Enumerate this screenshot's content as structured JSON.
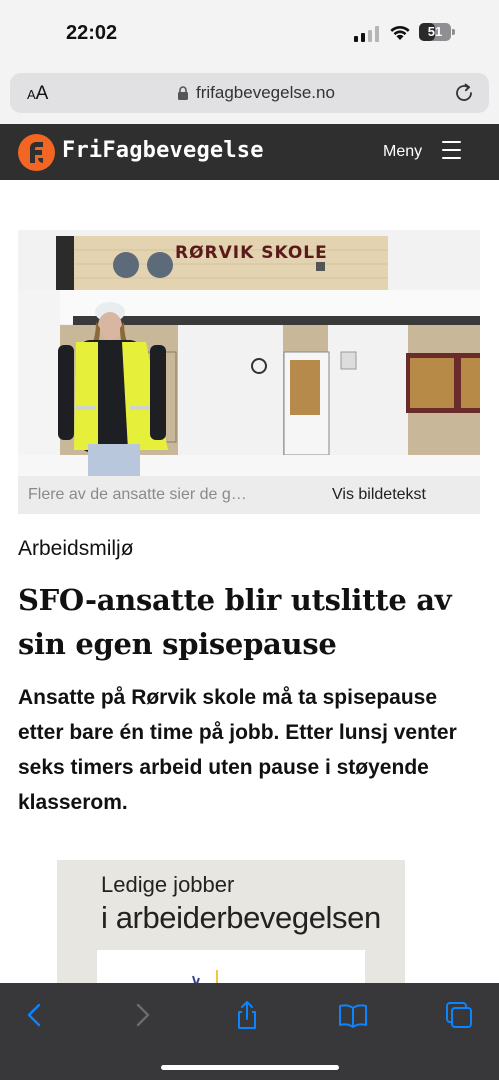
{
  "status_bar": {
    "time": "22:02",
    "battery": "51",
    "battery_level": 0.51,
    "icons": [
      "cellular-signal-icon",
      "wifi-icon",
      "battery-icon"
    ]
  },
  "browser": {
    "text_size_label": "AA",
    "url": "frifagbevegelse.no",
    "icons": [
      "lock-icon",
      "reload-icon"
    ]
  },
  "site_header": {
    "logo_text": "FriFagbevegelse",
    "menu_label": "Meny",
    "brand_color": "#f26522",
    "header_color": "#2f2f2f"
  },
  "article": {
    "image_caption": "Flere av de ansatte sier de g…",
    "caption_toggle": "Vis bildetekst",
    "image_sign_text": "RØRVIK SKOLE",
    "category": "Arbeidsmiljø",
    "headline": "SFO-ansatte blir utslitte av sin egen spisepause",
    "lead": "Ansatte på Rørvik skole må ta spisepause etter bare én time på jobb. Etter lunsj venter seks timers arbeid uten pause i støyende klasserom."
  },
  "ad": {
    "line1": "Ledige jobber",
    "line2": "i arbeiderbevegelsen"
  },
  "toolbar": {
    "buttons": [
      "back-icon",
      "forward-icon",
      "share-icon",
      "bookmarks-icon",
      "tabs-icon"
    ],
    "accent_color": "#0a84ff"
  }
}
